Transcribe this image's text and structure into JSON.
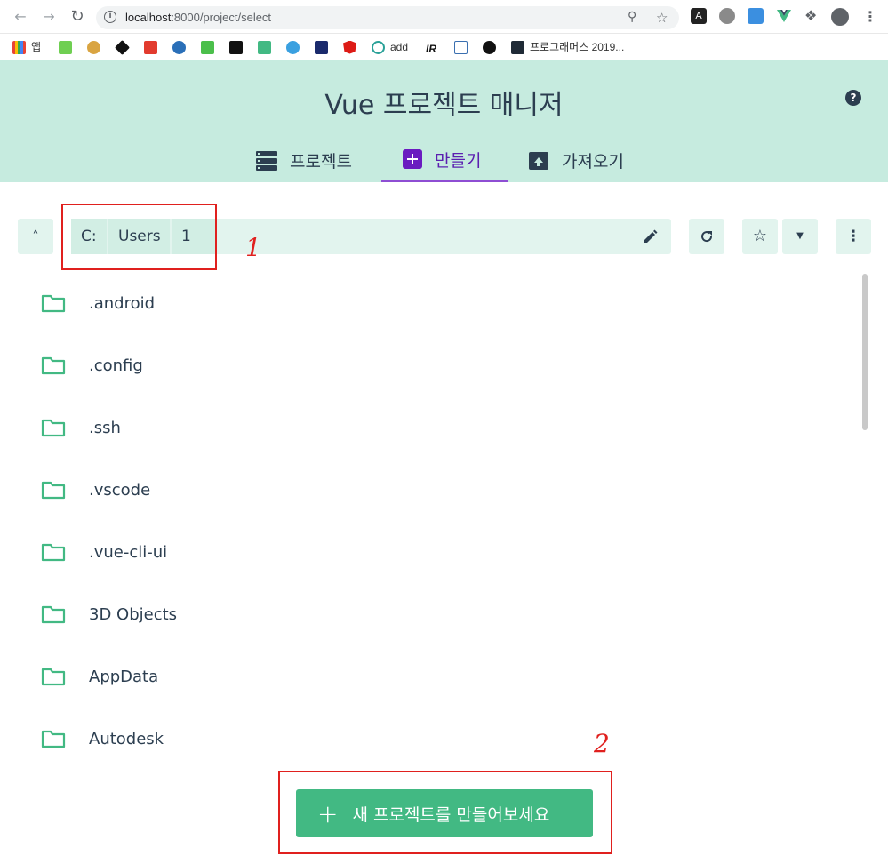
{
  "browser": {
    "url_host": "localhost",
    "url_rest": ":8000/project/select",
    "bookmarks": [
      {
        "label": "앱"
      },
      {
        "label": ""
      },
      {
        "label": ""
      },
      {
        "label": ""
      },
      {
        "label": ""
      },
      {
        "label": ""
      },
      {
        "label": ""
      },
      {
        "label": ""
      },
      {
        "label": ""
      },
      {
        "label": ""
      },
      {
        "label": ""
      },
      {
        "label": "add"
      },
      {
        "label": ""
      },
      {
        "label": ""
      },
      {
        "label": ""
      },
      {
        "label": "프로그래머스 2019..."
      }
    ]
  },
  "header": {
    "title": "Vue 프로젝트 매니저",
    "tabs": [
      {
        "label": "프로젝트"
      },
      {
        "label": "만들기"
      },
      {
        "label": "가져오기"
      }
    ],
    "active_tab": "만들기"
  },
  "pathbar": {
    "crumbs": [
      "C:",
      "Users",
      "1"
    ]
  },
  "folders": [
    {
      "name": ".android"
    },
    {
      "name": ".config"
    },
    {
      "name": ".ssh"
    },
    {
      "name": ".vscode"
    },
    {
      "name": ".vue-cli-ui"
    },
    {
      "name": "3D Objects"
    },
    {
      "name": "AppData"
    },
    {
      "name": "Autodesk"
    }
  ],
  "create_button": {
    "label": "새 프로젝트를 만들어보세요"
  },
  "annotations": [
    "1",
    "2"
  ],
  "colors": {
    "header_bg": "#c6ebdf",
    "accent_green": "#42b983",
    "active_tab": "#5b20b0",
    "annotation_red": "#e0201e"
  }
}
